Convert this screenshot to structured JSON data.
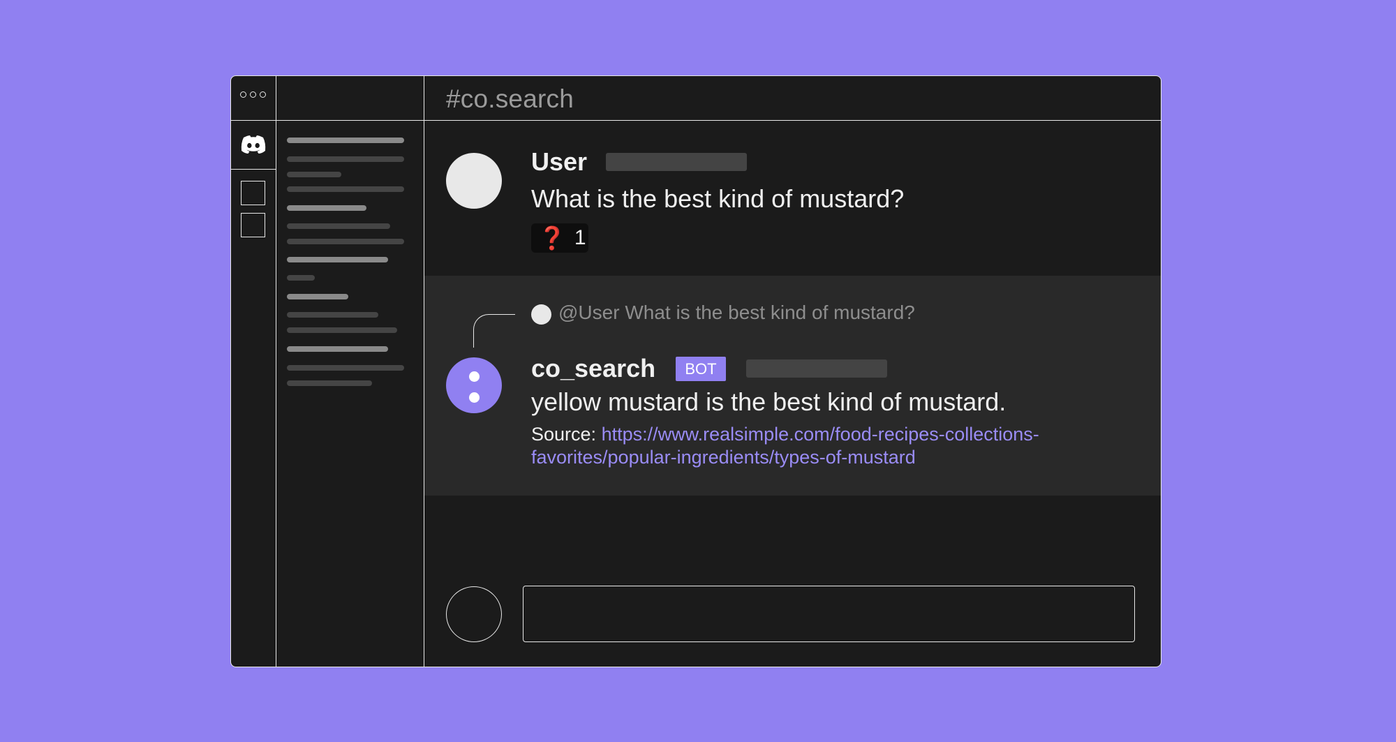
{
  "channel": {
    "title": "#co.search"
  },
  "messages": {
    "user": {
      "name": "User",
      "text": "What is the best kind of mustard?",
      "reaction": {
        "emoji": "❓",
        "count": "1"
      }
    },
    "bot": {
      "reply_preview": "@User What is the best kind of mustard?",
      "name": "co_search",
      "badge": "BOT",
      "text": "yellow mustard is the best kind of mustard.",
      "source_label": "Source:",
      "source_link": "https://www.realsimple.com/food-recipes-collections-favorites/popular-ingredients/types-of-mustard"
    }
  },
  "icons": {
    "window_controls": "three-dots-icon",
    "server": "discord-icon",
    "reaction": "question-mark-icon"
  },
  "colors": {
    "background": "#9080f1",
    "window": "#1b1b1b",
    "bot_section": "#292929",
    "accent": "#9080f1",
    "link": "#9a8cf5"
  }
}
